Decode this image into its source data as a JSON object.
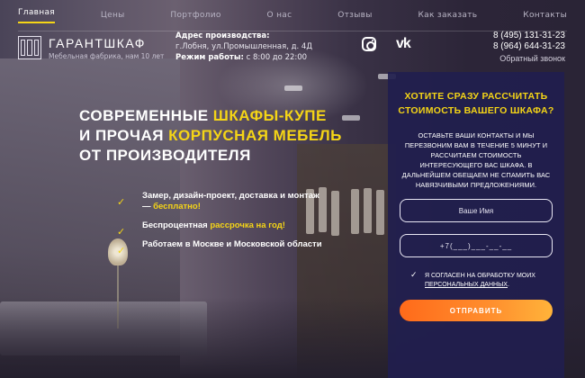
{
  "nav": {
    "items": [
      {
        "label": "Главная",
        "active": true
      },
      {
        "label": "Цены"
      },
      {
        "label": "Портфолио"
      },
      {
        "label": "О нас"
      },
      {
        "label": "Отзывы"
      },
      {
        "label": "Как заказать"
      },
      {
        "label": "Контакты"
      }
    ]
  },
  "logo": {
    "title": "ГАРАНТШКАФ",
    "subtitle": "Мебельная фабрика, нам 10 лет"
  },
  "address": {
    "label": "Адрес производства:",
    "value": "г.Лобня, ул.Промышленная, д. 4Д",
    "hours_label": "Режим работы:",
    "hours_value": "с 8:00 до 22:00"
  },
  "social": {
    "icons": [
      "instagram-icon",
      "vk-icon"
    ]
  },
  "contacts": {
    "phone1": "8 (495) 131-31-23",
    "phone2": "8 (964) 644-31-23",
    "callback": "Обратный звонок"
  },
  "hero": {
    "line1_a": "СОВРЕМЕННЫЕ ",
    "line1_b": "ШКАФЫ-КУПЕ",
    "line2_a": "И ПРОЧАЯ ",
    "line2_b": "КОРПУСНАЯ МЕБЕЛЬ",
    "line3": "ОТ ПРОИЗВОДИТЕЛЯ"
  },
  "bullets": [
    {
      "text": "Замер, дизайн-проект, доставка и монтаж — ",
      "highlight": "бесплатно!"
    },
    {
      "text": "Беспроцентная ",
      "highlight": "рассрочка на год!"
    },
    {
      "text": "Работаем в Москве и Московской области",
      "highlight": ""
    }
  ],
  "form": {
    "title": "ХОТИТЕ СРАЗУ РАССЧИТАТЬ СТОИМОСТЬ ВАШЕГО ШКАФА?",
    "description": "ОСТАВЬТЕ ВАШИ КОНТАКТЫ И МЫ ПЕРЕЗВОНИМ ВАМ В ТЕЧЕНИЕ 5 МИНУТ И РАССЧИТАЕМ СТОИМОСТЬ ИНТЕРЕСУЮЩЕГО ВАС ШКАФА. В ДАЛЬНЕЙШЕМ ОБЕЩАЕМ НЕ СПАМИТЬ ВАС НАВЯЗЧИВЫМИ ПРЕДЛОЖЕНИЯМИ.",
    "name_placeholder": "Ваше Имя",
    "phone_placeholder": "+7(___)___-__-__",
    "consent_text": "Я СОГЛАСЕН НА ОБРАБОТКУ МОИХ",
    "consent_link": "ПЕРСОНАЛЬНЫХ ДАННЫХ",
    "consent_end": ".",
    "submit": "ОТПРАВИТЬ"
  },
  "colors": {
    "accent": "#f5d516",
    "panel": "#211e4e",
    "button_start": "#ff6a1a",
    "button_end": "#ffb33a"
  }
}
